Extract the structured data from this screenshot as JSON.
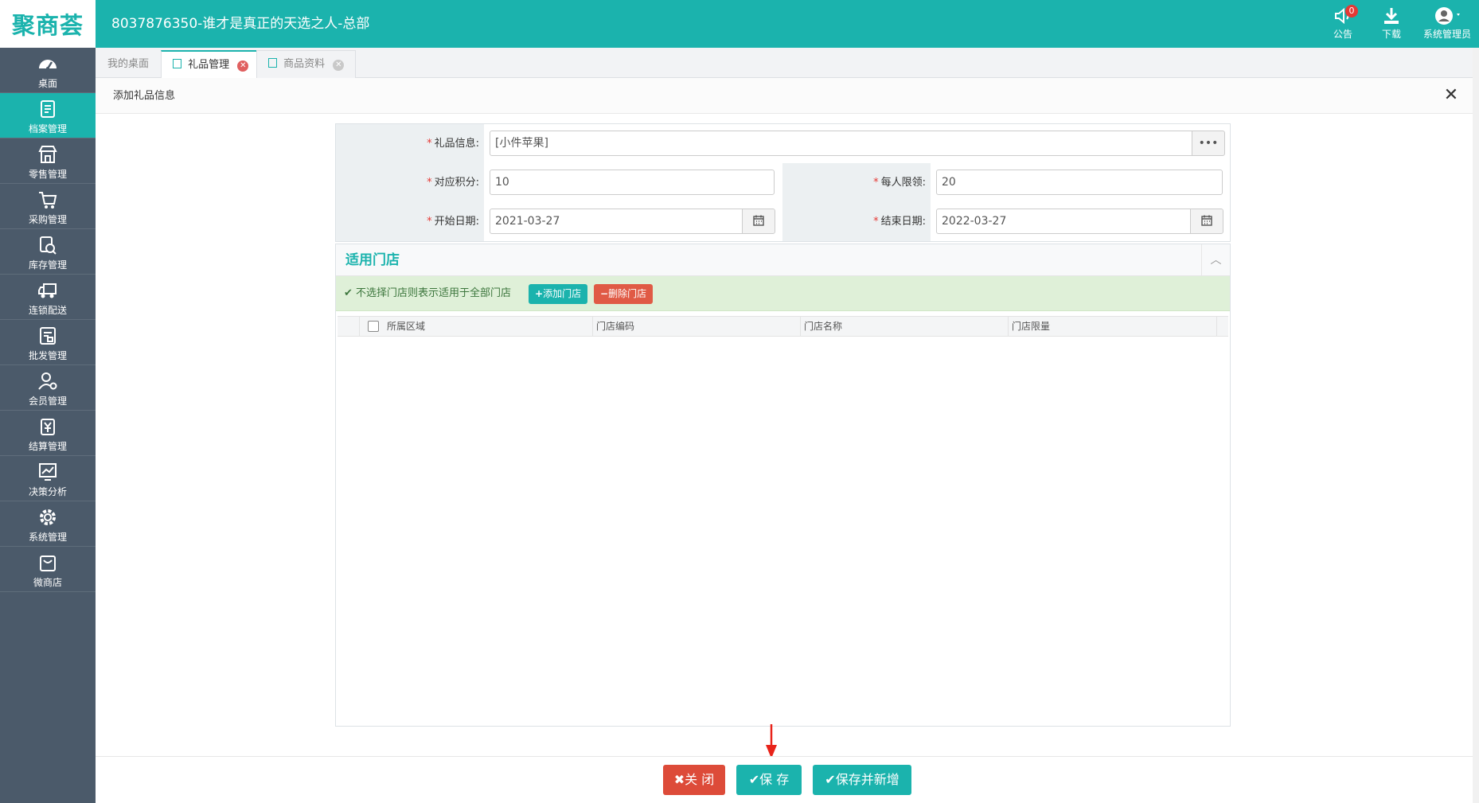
{
  "header": {
    "logo": "聚商荟",
    "title": "8037876350-谁才是真正的天选之人-总部",
    "actions": [
      {
        "name": "notice",
        "label": "公告",
        "badge": "0",
        "icon": "speaker-icon"
      },
      {
        "name": "download",
        "label": "下载",
        "icon": "download-icon"
      },
      {
        "name": "user",
        "label": "系统管理员",
        "icon": "avatar-icon"
      }
    ]
  },
  "sidebar": {
    "items": [
      {
        "label": "桌面",
        "icon": "dashboard-icon",
        "active": false
      },
      {
        "label": "档案管理",
        "icon": "archive-icon",
        "active": true
      },
      {
        "label": "零售管理",
        "icon": "store-icon",
        "active": false
      },
      {
        "label": "采购管理",
        "icon": "cart-icon",
        "active": false
      },
      {
        "label": "库存管理",
        "icon": "inventory-icon",
        "active": false
      },
      {
        "label": "连锁配送",
        "icon": "truck-icon",
        "active": false
      },
      {
        "label": "批发管理",
        "icon": "wholesale-icon",
        "active": false
      },
      {
        "label": "会员管理",
        "icon": "member-icon",
        "active": false
      },
      {
        "label": "结算管理",
        "icon": "settlement-icon",
        "active": false
      },
      {
        "label": "决策分析",
        "icon": "chart-icon",
        "active": false
      },
      {
        "label": "系统管理",
        "icon": "gear-icon",
        "active": false
      },
      {
        "label": "微商店",
        "icon": "shop-bag-icon",
        "active": false
      }
    ]
  },
  "tabs": [
    {
      "label": "我的桌面"
    },
    {
      "label": "礼品管理"
    },
    {
      "label": "商品资料"
    }
  ],
  "dialog": {
    "title": "添加礼品信息",
    "close_icon": "close-icon"
  },
  "form": {
    "gift_label": "礼品信息:",
    "gift_value": "[小件苹果]",
    "gift_picker": "•••",
    "points_label": "对应积分:",
    "points_value": "10",
    "limit_label": "每人限领:",
    "limit_value": "20",
    "start_label": "开始日期:",
    "start_value": "2021-03-27",
    "end_label": "结束日期:",
    "end_value": "2022-03-27",
    "required_mark": "*"
  },
  "stores": {
    "title": "适用门店",
    "notice": "不选择门店则表示适用于全部门店",
    "add_button": "添加门店",
    "delete_button": "删除门店",
    "columns": [
      "所属区域",
      "门店编码",
      "门店名称",
      "门店限量"
    ]
  },
  "footer": {
    "close": "关 闭",
    "save": "保 存",
    "save_new": "保存并新增"
  },
  "colors": {
    "brand": "#1bb3ad",
    "sidebar": "#4b5a6a",
    "danger": "#dd4b39"
  }
}
